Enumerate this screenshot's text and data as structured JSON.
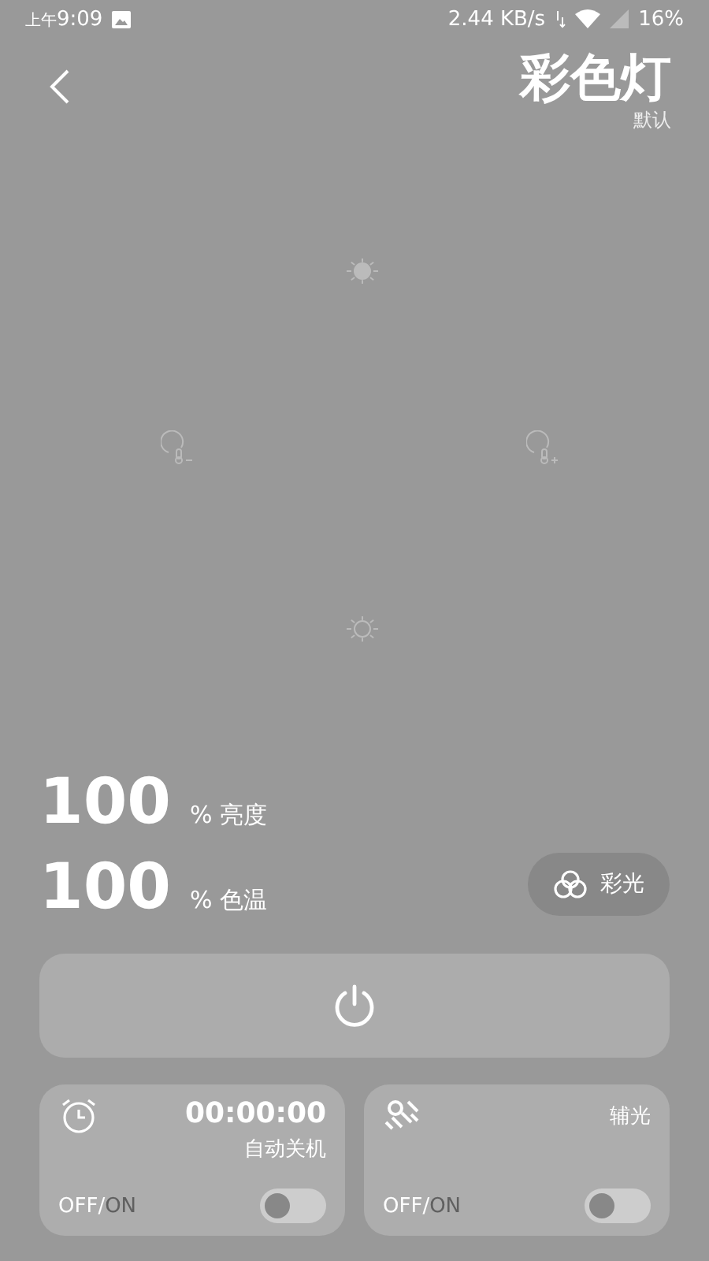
{
  "status_bar": {
    "time_prefix": "上午",
    "time": "9:09",
    "speed": "2.44 KB/s",
    "battery": "16%"
  },
  "header": {
    "title": "彩色灯",
    "subtitle": "默认"
  },
  "readings": [
    {
      "value": "100",
      "unit": "%",
      "label": "亮度"
    },
    {
      "value": "100",
      "unit": "%",
      "label": "色温"
    }
  ],
  "color_button": {
    "label": "彩光"
  },
  "cards": [
    {
      "kind": "timer",
      "time": "00:00:00",
      "label": "自动关机",
      "off_label": "OFF",
      "separator": "/",
      "on_label": "ON",
      "on": false
    },
    {
      "kind": "fill_light",
      "label": "辅光",
      "off_label": "OFF",
      "separator": "/",
      "on_label": "ON",
      "on": false
    }
  ]
}
